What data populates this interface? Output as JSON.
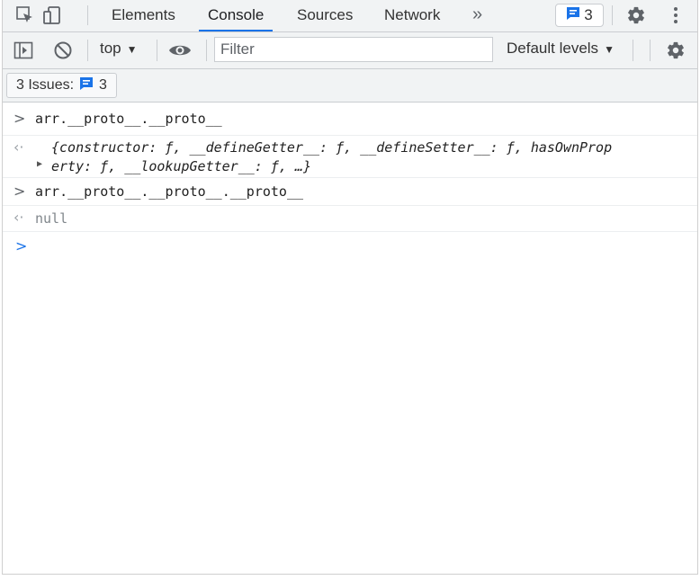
{
  "tabs": [
    "Elements",
    "Console",
    "Sources",
    "Network"
  ],
  "active_tab": "Console",
  "more_tabs_glyph": "»",
  "issues_count": "3",
  "toolbar": {
    "context": "top",
    "filter_placeholder": "Filter",
    "levels": "Default levels"
  },
  "issues_bar": {
    "label": "3 Issues:",
    "count": "3"
  },
  "console": {
    "entries": [
      {
        "type": "input",
        "text": "arr.__proto__.__proto__"
      },
      {
        "type": "result",
        "line1": "{constructor: ƒ, __defineGetter__: ƒ, __defineSetter__: ƒ, hasOwnProp",
        "line2": "erty: ƒ, __lookupGetter__: ƒ, …}"
      },
      {
        "type": "input",
        "text": "arr.__proto__.__proto__.__proto__"
      },
      {
        "type": "result",
        "text": "null"
      }
    ]
  },
  "colors": {
    "accent": "#1a73e8",
    "toolbar_bg": "#f1f3f4"
  }
}
